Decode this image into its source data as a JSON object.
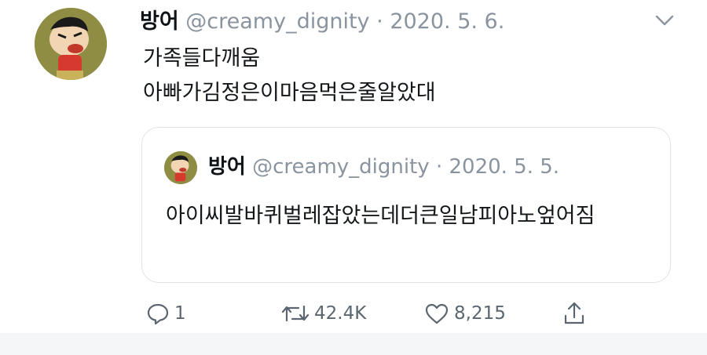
{
  "tweet": {
    "display_name": "방어",
    "handle": "@creamy_dignity",
    "separator": "·",
    "date": "2020. 5. 6.",
    "text_line1": "가족들다깨움",
    "text_line2": "아빠가김정은이마음먹은줄알았대",
    "menu_icon": "chevron-down-icon"
  },
  "quoted": {
    "display_name": "방어",
    "handle": "@creamy_dignity",
    "separator": "·",
    "date": "2020. 5. 5.",
    "text": "아이씨발바퀴벌레잡았는데더큰일남피아노엎어짐"
  },
  "actions": {
    "reply_count": "1",
    "retweet_count": "42.4K",
    "like_count": "8,215",
    "icons": [
      "reply-icon",
      "retweet-icon",
      "like-icon",
      "share-icon"
    ]
  },
  "colors": {
    "text": "#14171a",
    "secondary": "#8a949e",
    "border": "#dfe3e8",
    "icon": "#5b6670"
  }
}
